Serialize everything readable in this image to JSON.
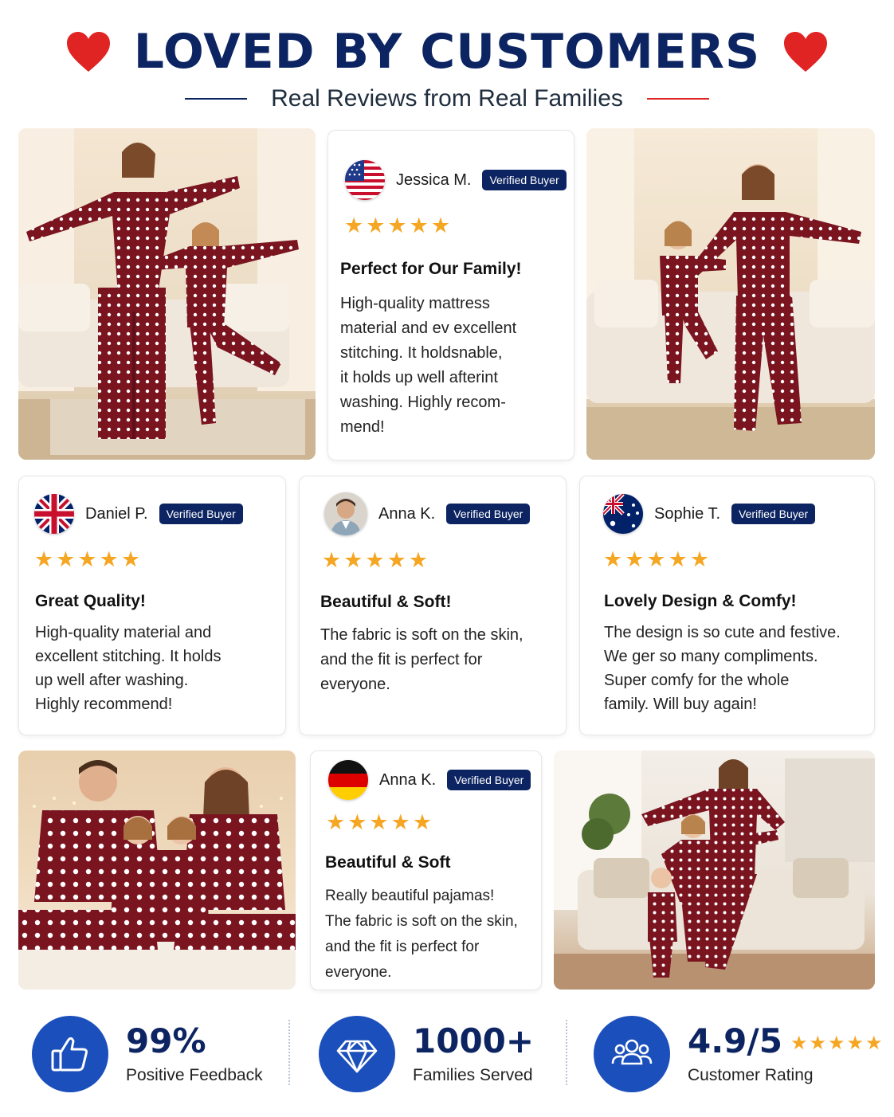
{
  "header": {
    "title": "LOVED BY CUSTOMERS",
    "subtitle": "Real Reviews from Real Families",
    "heart_color": "#e02424",
    "left_line_color": "#0c2461",
    "right_line_color": "#e02424"
  },
  "reviews": [
    {
      "name": "Jessica M.",
      "badge": "Verified Buyer",
      "flag": "usa-flag-icon",
      "stars": "★★★★★",
      "title": "Perfect for Our Family!",
      "body_lines": [
        "High-quality mattress",
        "material and ev excellent",
        "stitching. It holdsnable,",
        "it holds up well afterint",
        "washing. Highly recom-",
        "mend!"
      ]
    },
    {
      "name": "Daniel P.",
      "badge": "Verified Buyer",
      "flag": "uk-flag-icon",
      "stars": "★★★★★",
      "title": "Great Quality!",
      "body_lines": [
        "High-quality material and",
        "excellent stitching. It holds",
        "up well after washing.",
        "Highly recommend!"
      ]
    },
    {
      "name": "Anna K.",
      "badge": "Verified Buyer",
      "flag": "avatar-photo",
      "stars": "★★★★★",
      "title": "Beautiful & Soft!",
      "body_lines": [
        "The fabric is soft on the skin,",
        "and the fit is perfect for",
        "everyone."
      ]
    },
    {
      "name": "Sophie T.",
      "badge": "Verified Buyer",
      "flag": "australia-flag-icon",
      "stars": "★★★★★",
      "title": "Lovely Design & Comfy!",
      "body_lines": [
        "The design is so cute and festive.",
        "We ger so many compliments.",
        "Super comfy for the whole",
        "family. Will buy again!"
      ]
    },
    {
      "name": "Anna K.",
      "badge": "Verified Buyer",
      "flag": "germany-flag-icon",
      "stars": "★★★★★",
      "title": "Beautiful & Soft",
      "body_lines": [
        "Really beautiful pajamas!",
        "The fabric is soft on the skin,",
        "and the fit is perfect for",
        "everyone."
      ]
    }
  ],
  "stats": [
    {
      "icon": "thumbs-up-icon",
      "value": "99%",
      "label": "Positive Feedback"
    },
    {
      "icon": "diamond-icon",
      "value": "1000+",
      "label": "Families Served"
    },
    {
      "icon": "people-icon",
      "value": "4.9/5",
      "label": "Customer Rating",
      "stars": "★★★★★"
    }
  ],
  "colors": {
    "navy": "#0c2461",
    "star": "#f5a623",
    "stat_circle": "#1b4fbb",
    "pajama_red": "#7a1520"
  }
}
